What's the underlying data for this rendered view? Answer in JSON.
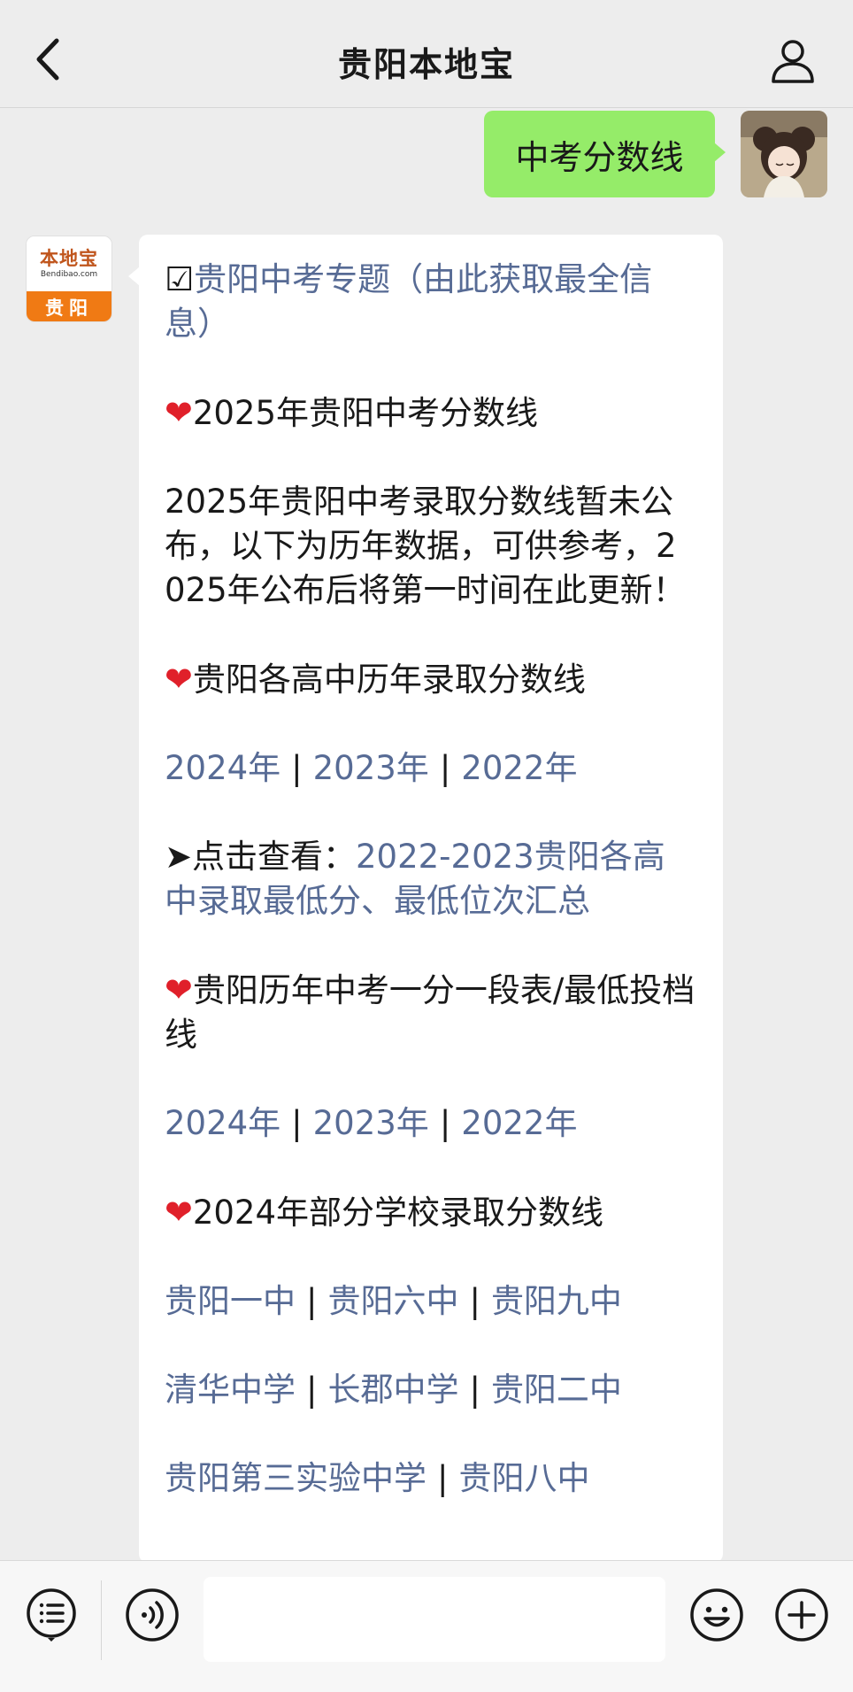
{
  "nav": {
    "title": "贵阳本地宝",
    "back_icon": "chevron-left-icon",
    "profile_icon": "person-icon"
  },
  "messages": {
    "user_message": "中考分数线",
    "bot_avatar": {
      "logo_text": "本地宝",
      "logo_url_text": "Bendibao.com",
      "city": "贵阳"
    }
  },
  "article": {
    "checkbox_glyph": "☑",
    "topic_link": "贵阳中考专题（由此获取最全信息）",
    "section1_title": "2025年贵阳中考分数线",
    "notice": "2025年贵阳中考录取分数线暂未公布，以下为历年数据，可供参考，2025年公布后将第一时间在此更新！",
    "section2_title": "贵阳各高中历年录取分数线",
    "years_a": [
      "2024年",
      "2023年",
      "2022年"
    ],
    "click_prefix": "➤点击查看：",
    "click_link": "2022-2023贵阳各高中录取最低分、最低位次汇总",
    "section3_title": "贵阳历年中考一分一段表/最低投档线",
    "years_b": [
      "2024年",
      "2023年",
      "2022年"
    ],
    "section4_title": "2024年部分学校录取分数线",
    "schools_row1": [
      "贵阳一中",
      "贵阳六中",
      "贵阳九中"
    ],
    "schools_row2": [
      "清华中学",
      "长郡中学",
      "贵阳二中"
    ],
    "schools_row3": [
      "贵阳第三实验中学",
      "贵阳八中"
    ],
    "separator": "|",
    "heart_glyph": "❤"
  },
  "inputbar": {
    "menu_icon": "list-menu-icon",
    "voice_icon": "voice-icon",
    "emoji_icon": "emoji-icon",
    "plus_icon": "plus-icon",
    "input_value": ""
  },
  "colors": {
    "link": "#576b95",
    "bubble_out": "#95ec69",
    "heart": "#e0202a",
    "background": "#ededed"
  }
}
